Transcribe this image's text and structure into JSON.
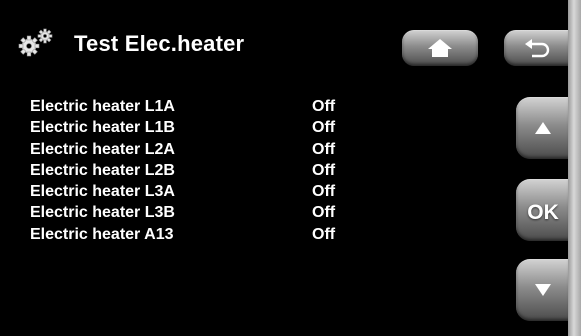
{
  "header": {
    "title": "Test Elec.heater",
    "icon": "gears-icon"
  },
  "nav": {
    "home_icon": "home-icon",
    "back_icon": "back-arrow-icon",
    "up_icon": "up-arrow-icon",
    "ok_label": "OK",
    "down_icon": "down-arrow-icon"
  },
  "list": {
    "items": [
      {
        "name": "Electric heater L1A",
        "value": "Off"
      },
      {
        "name": "Electric heater L1B",
        "value": "Off"
      },
      {
        "name": "Electric heater L2A",
        "value": "Off"
      },
      {
        "name": "Electric heater L2B",
        "value": "Off"
      },
      {
        "name": "Electric heater L3A",
        "value": "Off"
      },
      {
        "name": "Electric heater L3B",
        "value": "Off"
      },
      {
        "name": "Electric heater A13",
        "value": "Off"
      }
    ]
  },
  "colors": {
    "background": "#000000",
    "text": "#ffffff",
    "button_light": "#d3d3d3",
    "button_dark": "#4b4b4b"
  }
}
